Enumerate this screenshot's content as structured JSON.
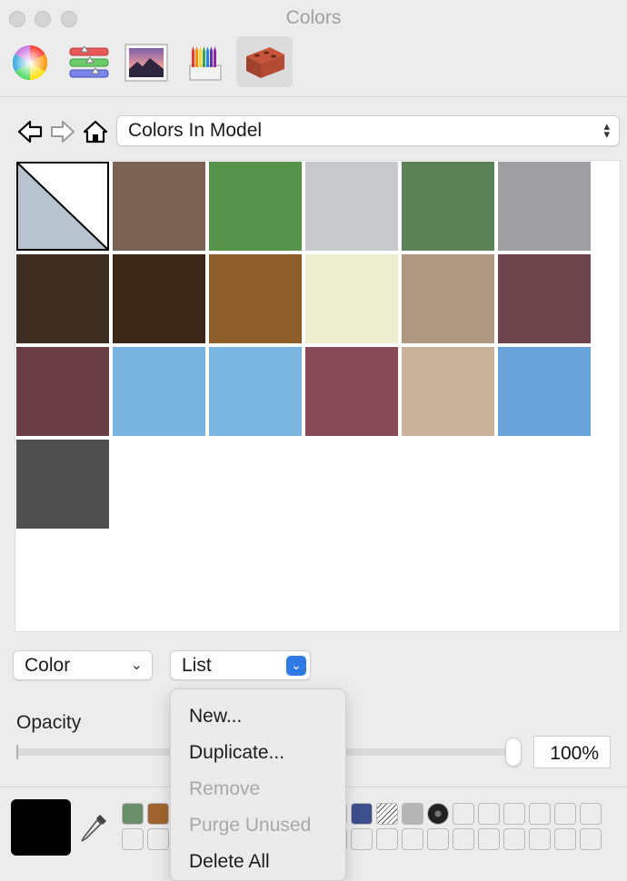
{
  "window": {
    "title": "Colors"
  },
  "toolbar": {
    "tabs": [
      {
        "name": "color-wheel-icon"
      },
      {
        "name": "color-sliders-icon"
      },
      {
        "name": "image-palette-icon"
      },
      {
        "name": "pencils-icon"
      },
      {
        "name": "brick-materials-icon",
        "selected": true
      }
    ]
  },
  "nav": {
    "back_icon": "back-arrow-icon",
    "forward_icon": "forward-arrow-icon",
    "home_icon": "home-icon",
    "collection": "Colors In Model"
  },
  "swatches": [
    {
      "color": "diagonal-none",
      "selected": true
    },
    {
      "color": "#7a6354"
    },
    {
      "color": "#56944b"
    },
    {
      "color": "#c8c9cc"
    },
    {
      "color": "#5b8157"
    },
    {
      "color": "#a09fa3"
    },
    {
      "color": "#3e2e22"
    },
    {
      "color": "#3c2617"
    },
    {
      "color": "#8e5e2a"
    },
    {
      "color": "#eeeed0"
    },
    {
      "color": "#b09782"
    },
    {
      "color": "#6f454d"
    },
    {
      "color": "#6a3c45"
    },
    {
      "color": "#79b5e0"
    },
    {
      "color": "#7bb6e1"
    },
    {
      "color": "#874a56"
    },
    {
      "color": "#cbb29a"
    },
    {
      "color": "#6aa2db"
    },
    {
      "color": "#4f4f4f"
    }
  ],
  "controls": {
    "mode_select": "Color",
    "view_select": "List"
  },
  "opacity": {
    "label": "Opacity",
    "value_text": "100%",
    "level": 1.0
  },
  "list_menu": {
    "items": [
      {
        "label": "New...",
        "enabled": true
      },
      {
        "label": "Duplicate...",
        "enabled": true
      },
      {
        "label": "Remove",
        "enabled": false
      },
      {
        "label": "Purge Unused",
        "enabled": false
      },
      {
        "label": "Delete All",
        "enabled": true
      }
    ]
  },
  "bottom": {
    "current_color": "#000000",
    "dropper_icon": "eyedropper-icon"
  }
}
